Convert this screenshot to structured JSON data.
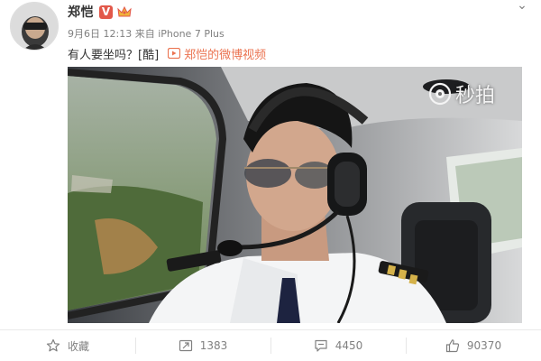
{
  "post": {
    "username": "郑恺",
    "vip_badge": "V",
    "timestamp": "9月6日 12:13",
    "source": "来自 iPhone 7 Plus",
    "text": "有人要坐吗？[酷]",
    "video_link_label": "郑恺的微博视频"
  },
  "video": {
    "watermark": "秒拍",
    "topic": "pilot in helicopter cockpit"
  },
  "actions": {
    "favorite_label": "收藏",
    "repost_count": "1383",
    "comment_count": "4450",
    "like_count": "90370"
  },
  "colors": {
    "link": "#eb7350",
    "vip": "#e2584a",
    "muted": "#808080"
  }
}
